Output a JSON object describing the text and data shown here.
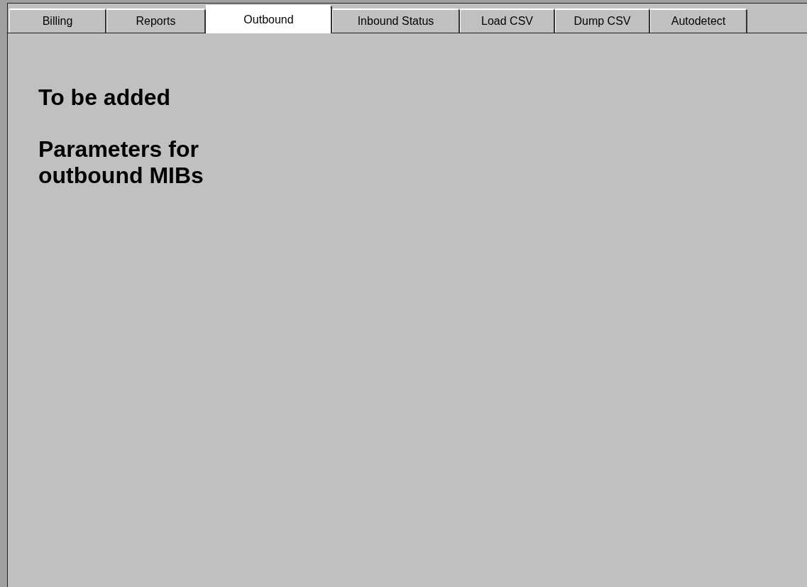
{
  "tabs": [
    {
      "label": "Billing",
      "selected": false
    },
    {
      "label": "Reports",
      "selected": false
    },
    {
      "label": "Outbound",
      "selected": true
    },
    {
      "label": "Inbound Status",
      "selected": false
    },
    {
      "label": "Load CSV",
      "selected": false
    },
    {
      "label": "Dump CSV",
      "selected": false
    },
    {
      "label": "Autodetect",
      "selected": false
    }
  ],
  "content": {
    "headings": [
      "To be added",
      "Parameters for outbound MIBs"
    ]
  }
}
